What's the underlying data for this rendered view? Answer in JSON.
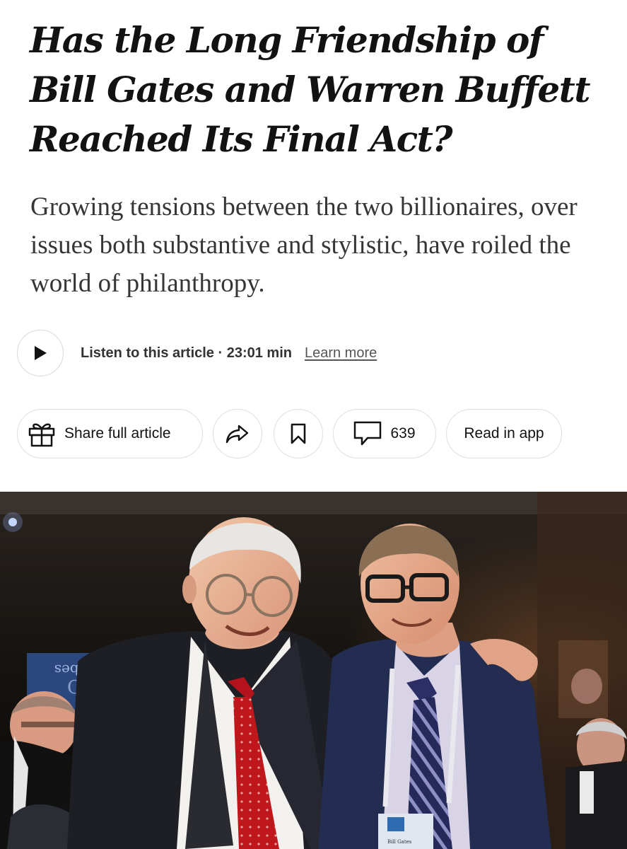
{
  "article": {
    "headline": "Has the Long Friendship of Bill Gates and Warren Buffett Reached Its Final Act?",
    "summary": "Growing tensions between the two billionaires, over issues both substantive and stylistic, have roiled the world of philanthropy."
  },
  "audio": {
    "play_icon": "play-icon",
    "listen_label": "Listen to this article · 23:01 min",
    "learn_more": "Learn more"
  },
  "actions": {
    "share_icon": "gift-icon",
    "share_label": "Share full article",
    "forward_icon": "share-arrow-icon",
    "bookmark_icon": "bookmark-icon",
    "comment_icon": "comment-icon",
    "comments_count": "639",
    "read_in_app": "Read in app"
  },
  "photo": {
    "backdrop_logo": "Forbes",
    "badge_name": "Bill Gates"
  }
}
